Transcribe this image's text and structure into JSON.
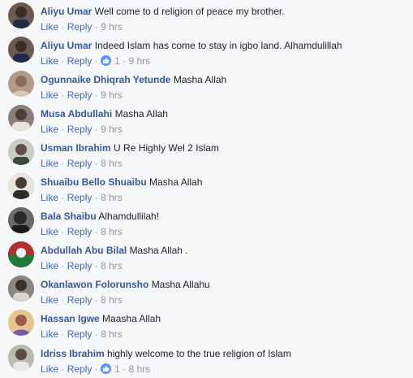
{
  "actions": {
    "like": "Like",
    "reply": "Reply",
    "separator": "·"
  },
  "comments": [
    {
      "author": "Aliyu Umar",
      "text": "Well come to d religion of peace my brother.",
      "likes": null,
      "time": "9 hrs",
      "avatar_color": "#6b5a4f"
    },
    {
      "author": "Aliyu Umar",
      "text": "Indeed Islam has come to stay in igbo land. Alhamdulillah",
      "likes": "1",
      "time": "9 hrs",
      "avatar_color": "#6b5a4f"
    },
    {
      "author": "Ogunnaike Dhiqrah Yetunde",
      "text": "Masha Allah",
      "likes": null,
      "time": "9 hrs",
      "avatar_color": "#b39a8a"
    },
    {
      "author": "Musa Abdullahi",
      "text": "Masha Allah",
      "likes": null,
      "time": "9 hrs",
      "avatar_color": "#8a7e7a"
    },
    {
      "author": "Usman Ibrahim",
      "text": "U Re Highly Wel 2 Islam",
      "likes": null,
      "time": "8 hrs",
      "avatar_color": "#9aa09a"
    },
    {
      "author": "Shuaibu Bello Shuaibu",
      "text": "Masha Allah",
      "likes": null,
      "time": "8 hrs",
      "avatar_color": "#7a6a5e"
    },
    {
      "author": "Bala Shaibu",
      "text": "Alhamdullilah!",
      "likes": null,
      "time": "8 hrs",
      "avatar_color": "#4a4a4a"
    },
    {
      "author": "Abdullah Abu Bilal",
      "text": "Masha Allah .",
      "likes": null,
      "time": "8 hrs",
      "avatar_color": "#a0282a"
    },
    {
      "author": "Okanlawon Folorunsho",
      "text": "Masha Allahu",
      "likes": null,
      "time": "8 hrs",
      "avatar_color": "#5d5552"
    },
    {
      "author": "Hassan Igwe",
      "text": "Maasha Allah",
      "likes": null,
      "time": "8 hrs",
      "avatar_color": "#c4a06a"
    },
    {
      "author": "Idriss Ibrahim",
      "text": "highly welcome to the true religion of Islam",
      "likes": "1",
      "time": "8 hrs",
      "avatar_color": "#9a9d93"
    }
  ]
}
